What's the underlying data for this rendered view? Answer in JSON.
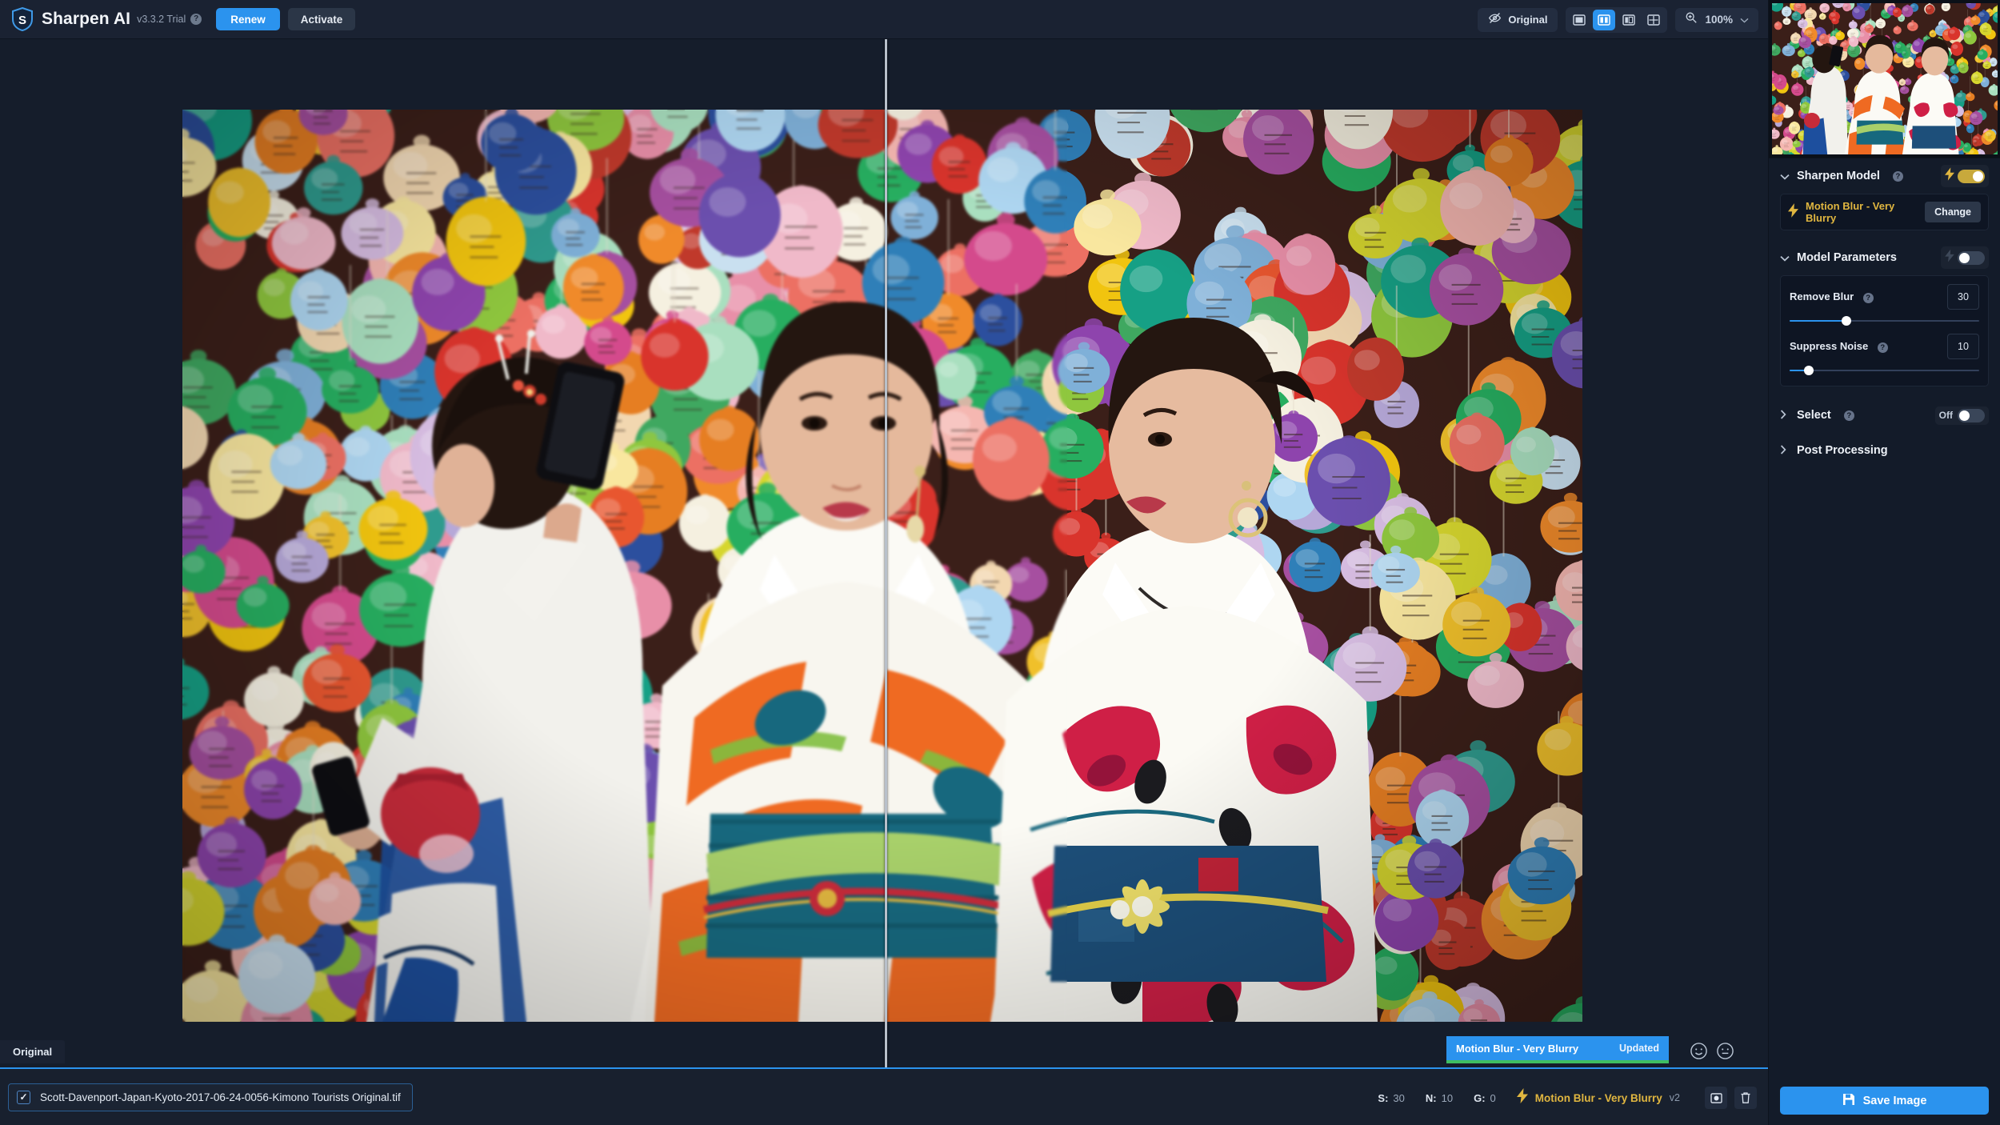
{
  "app": {
    "name": "Sharpen AI",
    "version": "v3.3.2 Trial",
    "help_icon": "help-icon",
    "logo_icon": "sharpen-ai-shield-logo",
    "renew_label": "Renew",
    "activate_label": "Activate"
  },
  "toolbar": {
    "original_toggle": {
      "label": "Original",
      "icon": "eye-off-icon"
    },
    "view_modes": [
      {
        "id": "single",
        "icon": "single-view-icon",
        "active": false
      },
      {
        "id": "split",
        "icon": "split-view-icon",
        "active": true
      },
      {
        "id": "side-by-side",
        "icon": "side-by-side-view-icon",
        "active": false
      },
      {
        "id": "quad",
        "icon": "quad-view-icon",
        "active": false
      }
    ],
    "zoom": {
      "icon": "zoom-in-icon",
      "level": "100%",
      "chevron": "chevron-down-icon"
    }
  },
  "canvas": {
    "original_badge": "Original",
    "split_handle": "split-divider"
  },
  "toast": {
    "title": "Motion Blur - Very Blurry",
    "status": "Updated",
    "progress_percent": 100,
    "progress_color": "#3fbf62",
    "background_color": "#2b93ee",
    "feedback_icons": [
      "smiley-happy-icon",
      "smiley-neutral-icon"
    ]
  },
  "statusbar": {
    "file_checked": true,
    "check_glyph": "✓",
    "filename": "Scott-Davenport-Japan-Kyoto-2017-06-24-0056-Kimono Tourists Original.tif",
    "stats": [
      {
        "key": "S:",
        "value": "30"
      },
      {
        "key": "N:",
        "value": "10"
      },
      {
        "key": "G:",
        "value": "0"
      }
    ],
    "model": {
      "icon": "lightning-bolt-icon",
      "name": "Motion Blur - Very Blurry",
      "version": "v2"
    },
    "actions": [
      {
        "id": "compare",
        "icon": "compare-icon"
      },
      {
        "id": "delete",
        "icon": "trash-icon"
      }
    ]
  },
  "right_panel": {
    "navigator": {
      "name": "navigator-preview"
    },
    "sharpen_model": {
      "title": "Sharpen Model",
      "chevron": "⌄",
      "expanded": true,
      "help_icon": "help-icon",
      "toggle": {
        "state": "on",
        "icon": "lightning-bolt-icon",
        "color": "#c8a93c"
      },
      "selected_model": "Motion Blur - Very Blurry",
      "model_icon": "lightning-bolt-icon",
      "change_label": "Change"
    },
    "model_parameters": {
      "title": "Model Parameters",
      "chevron": "⌄",
      "expanded": true,
      "toggle": {
        "state": "off",
        "icon": "lightning-bolt-icon"
      },
      "params": [
        {
          "label": "Remove Blur",
          "value": "30",
          "percent": 30,
          "help_icon": "help-icon"
        },
        {
          "label": "Suppress Noise",
          "value": "10",
          "percent": 10,
          "help_icon": "help-icon"
        }
      ]
    },
    "select": {
      "title": "Select",
      "chevron": "›",
      "expanded": false,
      "help_icon": "help-icon",
      "toggle": {
        "state": "off",
        "label": "Off"
      }
    },
    "post_processing": {
      "title": "Post Processing",
      "chevron": "›",
      "expanded": false
    },
    "save": {
      "label": "Save Image",
      "icon": "save-disk-icon",
      "color": "#2b93ee"
    }
  }
}
